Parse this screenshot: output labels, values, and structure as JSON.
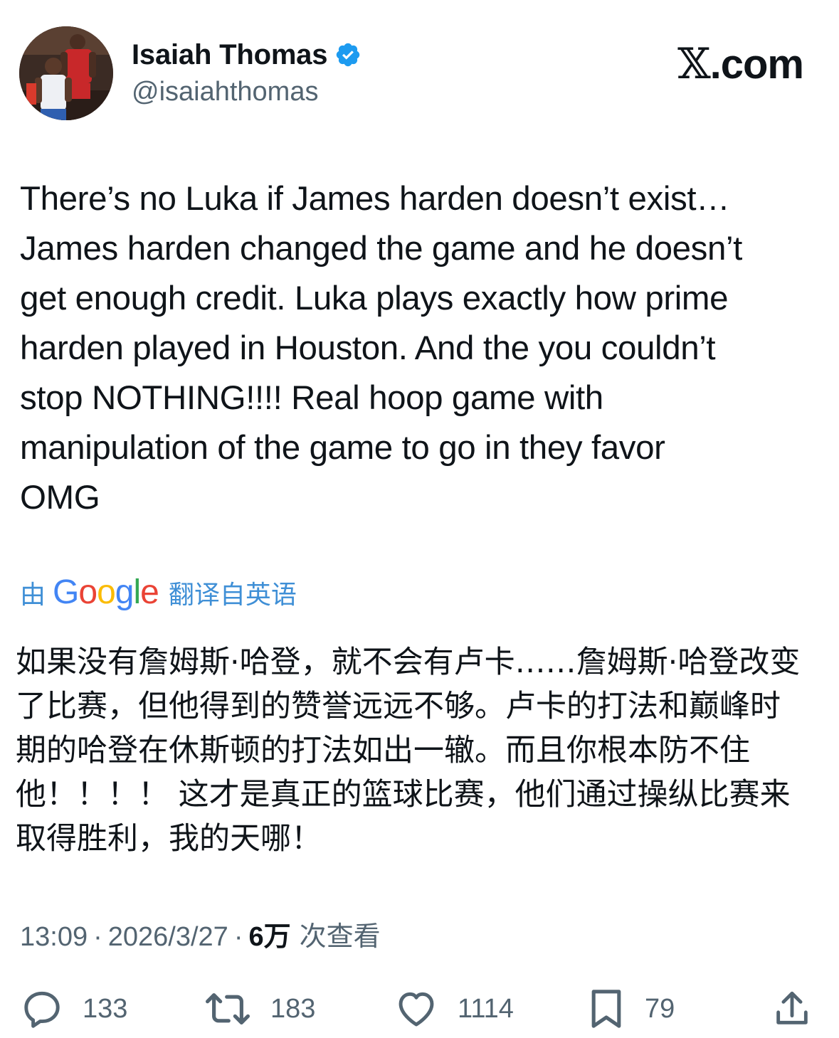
{
  "author": {
    "display_name": "Isaiah Thomas",
    "handle": "@isaiahthomas",
    "verified": true
  },
  "brand": {
    "x_glyph": "𝕏",
    "label": ".com"
  },
  "tweet": {
    "lines": [
      "There’s no Luka if James harden doesn’t exist…",
      "James harden changed the game and he doesn’t",
      "get enough credit. Luka plays exactly how prime",
      "harden played in Houston. And the you couldn’t",
      "stop NOTHING!!!! Real hoop game with",
      "manipulation of the game to go in they favor",
      "OMG"
    ]
  },
  "translation": {
    "by_label": "由",
    "google_letters": [
      "G",
      "o",
      "o",
      "g",
      "l",
      "e"
    ],
    "google_colors": [
      "#4285F4",
      "#EA4335",
      "#FBBC05",
      "#4285F4",
      "#34A853",
      "#EA4335"
    ],
    "source_label": "翻译自英语",
    "lines": [
      "如果没有詹姆斯·哈登，就不会有卢卡……詹姆斯·哈登改变",
      "了比赛，但他得到的赞誉远远不够。卢卡的打法和巅峰时",
      "期的哈登在休斯顿的打法如出一辙。而且你根本防不住",
      "他！！！！ 这才是真正的篮球比赛，他们通过操纵比赛来",
      "取得胜利，我的天哪！"
    ]
  },
  "meta": {
    "time": "13:09",
    "date": "2026/3/27",
    "separator": "·",
    "views_count": "6万",
    "views_label": "次查看"
  },
  "actions": {
    "replies": "133",
    "reposts": "183",
    "likes": "1114",
    "bookmarks": "79"
  },
  "colors": {
    "text": "#0f1419",
    "secondary": "#536471",
    "verified_blue": "#1d9bf0",
    "translate_blue": "#3f8fd6"
  }
}
